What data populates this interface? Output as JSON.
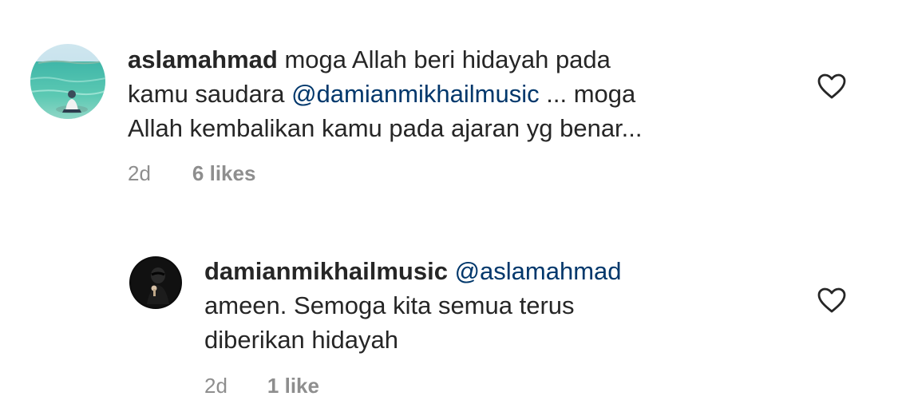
{
  "comments": [
    {
      "username": "aslamahmad",
      "text_1": " moga Allah beri hidayah pada",
      "text_2": "kamu saudara ",
      "mention": "@damianmikhailmusic",
      "text_3": " ... moga",
      "text_4": "Allah kembalikan kamu pada ajaran yg benar...",
      "time": "2d",
      "likes": "6 likes",
      "avatar_icon": "beach-photo-avatar",
      "like_icon": "heart-outline-icon"
    },
    {
      "username": "damianmikhailmusic",
      "mention": "@aslamahmad",
      "text_1": "ameen. Semoga kita semua terus",
      "text_2": "diberikan hidayah",
      "time": "2d",
      "likes": "1 like",
      "avatar_icon": "dark-portrait-avatar",
      "like_icon": "heart-outline-icon"
    }
  ],
  "colors": {
    "text": "#262626",
    "mention": "#00376b",
    "meta": "#8e8e8e"
  }
}
